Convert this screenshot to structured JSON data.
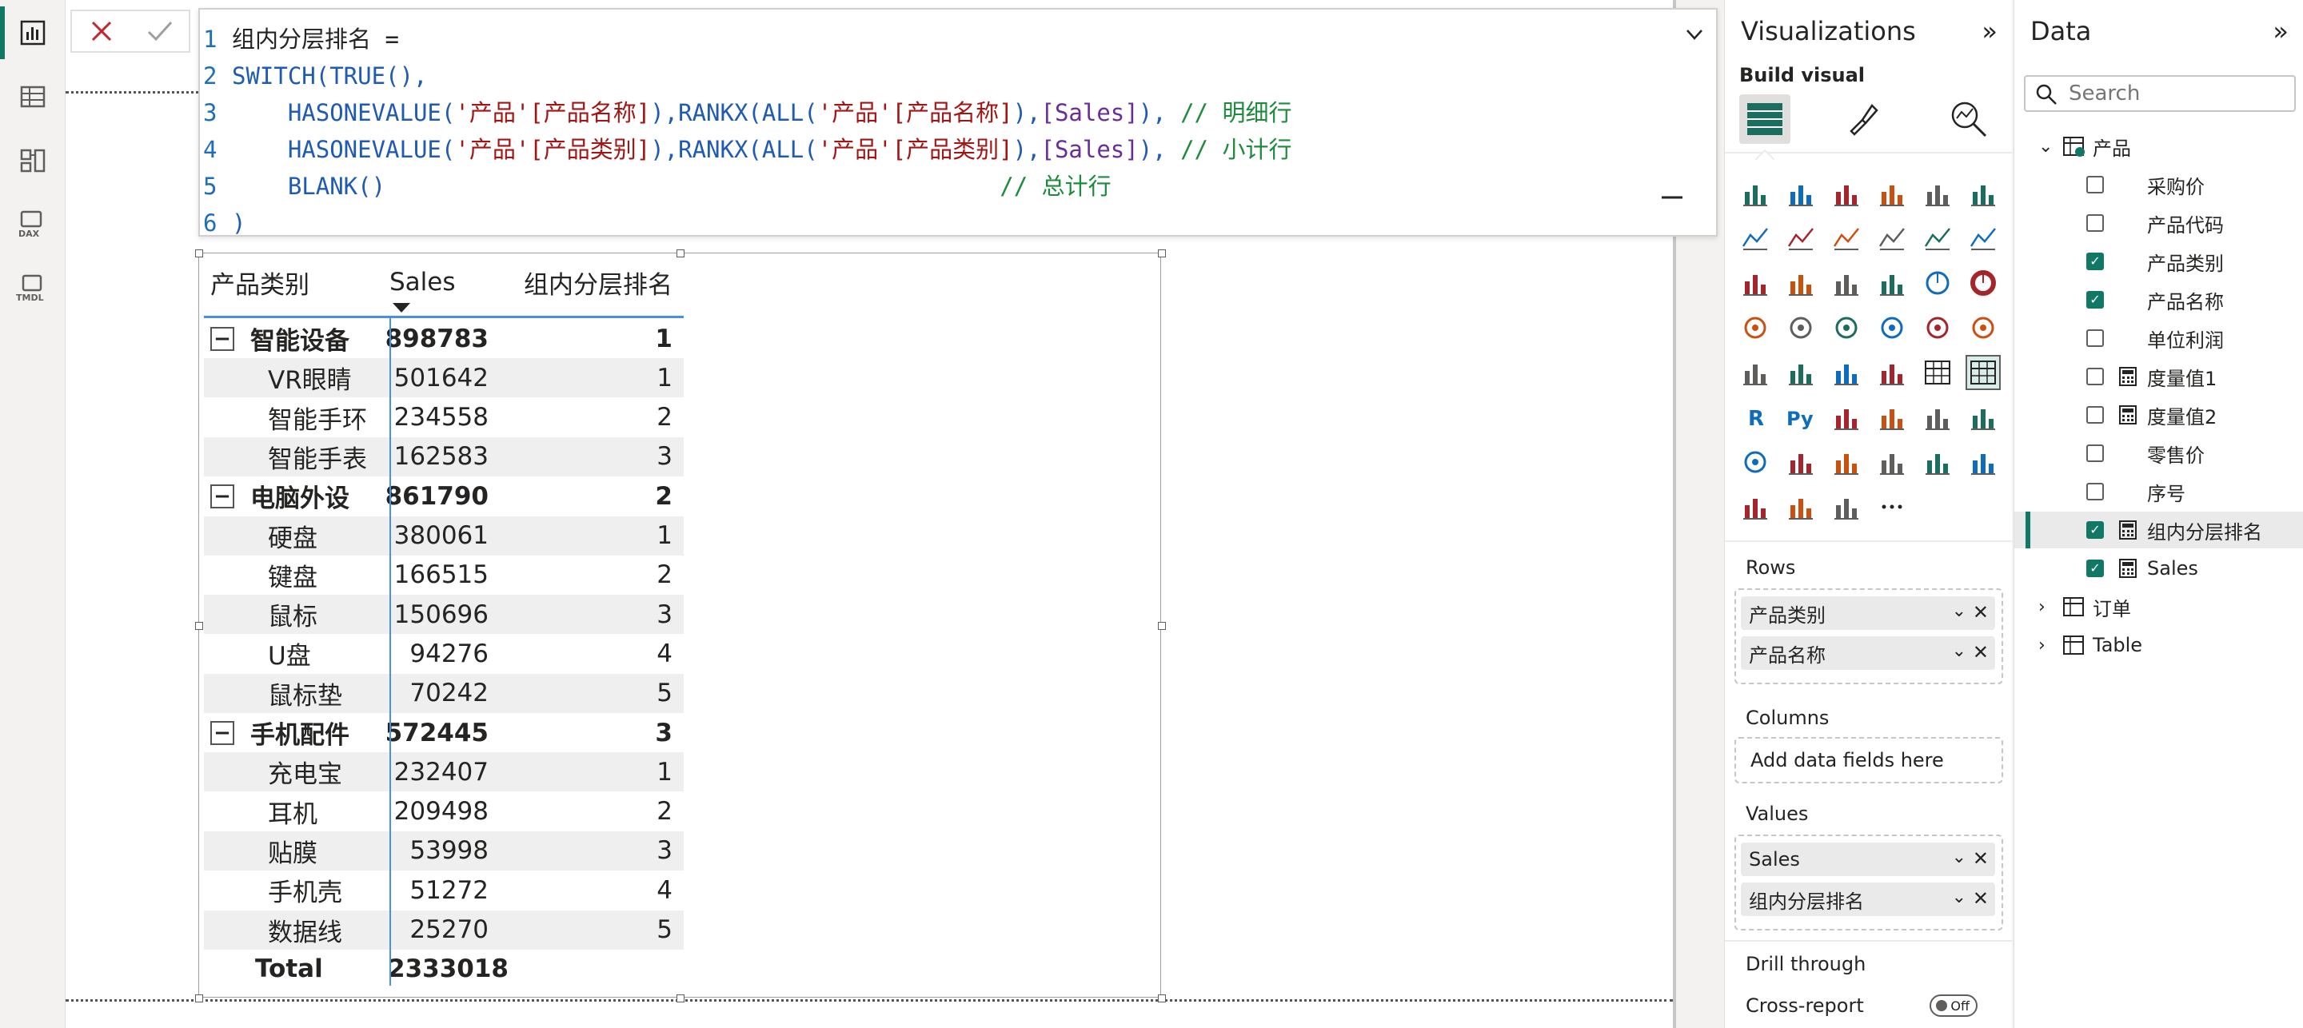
{
  "formula": {
    "lines": [
      {
        "no": "1",
        "segments": [
          {
            "t": "组内分层排名 =",
            "c": "c-tx"
          }
        ]
      },
      {
        "no": "2",
        "segments": [
          {
            "t": "SWITCH(TRUE(),",
            "c": "c-kw"
          }
        ]
      },
      {
        "no": "3",
        "segments": [
          {
            "t": "    HASONEVALUE(",
            "c": "c-kw"
          },
          {
            "t": "'产品'[产品名称]",
            "c": "c-str"
          },
          {
            "t": "),RANKX(ALL(",
            "c": "c-kw"
          },
          {
            "t": "'产品'[产品名称]",
            "c": "c-str"
          },
          {
            "t": "),",
            "c": "c-kw"
          },
          {
            "t": "[Sales]",
            "c": "c-ms"
          },
          {
            "t": "), ",
            "c": "c-kw"
          },
          {
            "t": "// 明细行",
            "c": "c-cm"
          }
        ]
      },
      {
        "no": "4",
        "segments": [
          {
            "t": "    HASONEVALUE(",
            "c": "c-kw"
          },
          {
            "t": "'产品'[产品类别]",
            "c": "c-str"
          },
          {
            "t": "),RANKX(ALL(",
            "c": "c-kw"
          },
          {
            "t": "'产品'[产品类别]",
            "c": "c-str"
          },
          {
            "t": "),",
            "c": "c-kw"
          },
          {
            "t": "[Sales]",
            "c": "c-ms"
          },
          {
            "t": "), ",
            "c": "c-kw"
          },
          {
            "t": "// 小计行",
            "c": "c-cm"
          }
        ]
      },
      {
        "no": "5",
        "segments": [
          {
            "t": "    BLANK()",
            "c": "c-kw"
          },
          {
            "t": "                                            // 总计行",
            "c": "c-cm"
          }
        ]
      },
      {
        "no": "6",
        "segments": [
          {
            "t": ")",
            "c": "c-kw"
          }
        ]
      }
    ]
  },
  "matrix": {
    "headers": [
      "产品类别",
      "Sales",
      "组内分层排名"
    ],
    "rows": [
      {
        "kind": "group",
        "label": "智能设备",
        "sales": "898783",
        "rank": "1"
      },
      {
        "kind": "item",
        "label": "VR眼睛",
        "sales": "501642",
        "rank": "1"
      },
      {
        "kind": "item",
        "label": "智能手环",
        "sales": "234558",
        "rank": "2"
      },
      {
        "kind": "item",
        "label": "智能手表",
        "sales": "162583",
        "rank": "3"
      },
      {
        "kind": "group",
        "label": "电脑外设",
        "sales": "861790",
        "rank": "2"
      },
      {
        "kind": "item",
        "label": "硬盘",
        "sales": "380061",
        "rank": "1"
      },
      {
        "kind": "item",
        "label": "键盘",
        "sales": "166515",
        "rank": "2"
      },
      {
        "kind": "item",
        "label": "鼠标",
        "sales": "150696",
        "rank": "3"
      },
      {
        "kind": "item",
        "label": "U盘",
        "sales": "94276",
        "rank": "4"
      },
      {
        "kind": "item",
        "label": "鼠标垫",
        "sales": "70242",
        "rank": "5"
      },
      {
        "kind": "group",
        "label": "手机配件",
        "sales": "572445",
        "rank": "3"
      },
      {
        "kind": "item",
        "label": "充电宝",
        "sales": "232407",
        "rank": "1"
      },
      {
        "kind": "item",
        "label": "耳机",
        "sales": "209498",
        "rank": "2"
      },
      {
        "kind": "item",
        "label": "贴膜",
        "sales": "53998",
        "rank": "3"
      },
      {
        "kind": "item",
        "label": "手机壳",
        "sales": "51272",
        "rank": "4"
      },
      {
        "kind": "item",
        "label": "数据线",
        "sales": "25270",
        "rank": "5"
      },
      {
        "kind": "total",
        "label": "Total",
        "sales": "2333018",
        "rank": ""
      }
    ]
  },
  "viz": {
    "title": "Visualizations",
    "build_visual": "Build visual",
    "rows_label": "Rows",
    "rows_fields": [
      "产品类别",
      "产品名称"
    ],
    "columns_label": "Columns",
    "columns_placeholder": "Add data fields here",
    "values_label": "Values",
    "values_fields": [
      "Sales",
      "组内分层排名"
    ],
    "drill_through": "Drill through",
    "cross_report": "Cross-report",
    "toggle_off": "Off"
  },
  "data_pane": {
    "title": "Data",
    "search_placeholder": "Search",
    "tables": [
      {
        "name": "产品",
        "expanded": true,
        "fields": [
          {
            "name": "采购价",
            "checked": false,
            "measure": false
          },
          {
            "name": "产品代码",
            "checked": false,
            "measure": false
          },
          {
            "name": "产品类别",
            "checked": true,
            "measure": false
          },
          {
            "name": "产品名称",
            "checked": true,
            "measure": false
          },
          {
            "name": "单位利润",
            "checked": false,
            "measure": false
          },
          {
            "name": "度量值1",
            "checked": false,
            "measure": true
          },
          {
            "name": "度量值2",
            "checked": false,
            "measure": true
          },
          {
            "name": "零售价",
            "checked": false,
            "measure": false
          },
          {
            "name": "序号",
            "checked": false,
            "measure": false
          },
          {
            "name": "组内分层排名",
            "checked": true,
            "measure": true,
            "selected": true
          },
          {
            "name": "Sales",
            "checked": true,
            "measure": true
          }
        ]
      },
      {
        "name": "订单",
        "expanded": false,
        "fields": []
      },
      {
        "name": "Table",
        "expanded": false,
        "fields": []
      }
    ]
  },
  "colors": {
    "accent": "#117865",
    "code_blue": "#1f5bb5",
    "code_string": "#a31515",
    "code_comment": "#1e8a3c",
    "selection_line": "#4a90e2"
  }
}
